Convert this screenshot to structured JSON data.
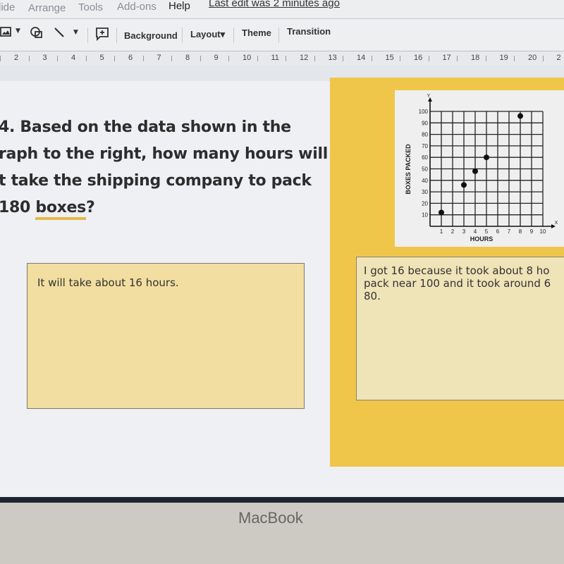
{
  "menubar": {
    "items": [
      "lide",
      "Arrange",
      "Tools",
      "Add-ons",
      "Help"
    ],
    "last_edit": "Last edit was 2 minutes ago"
  },
  "toolbar": {
    "icons": [
      "image-icon",
      "shape-icon",
      "line-icon",
      "comment-add-icon"
    ],
    "buttons": [
      "Background",
      "Layout",
      "Theme",
      "Transition"
    ],
    "layout_arrow": "▾"
  },
  "ruler": {
    "numbers": [
      "2",
      "3",
      "4",
      "5",
      "6",
      "7",
      "8",
      "9",
      "10",
      "11",
      "12",
      "13",
      "14",
      "15",
      "16",
      "17",
      "18",
      "19",
      "20",
      "2"
    ]
  },
  "slide": {
    "question_lines": [
      "4. Based on the data shown in the",
      "raph to the right, how many hours will",
      "t take the shipping company to pack",
      "180 boxes?"
    ],
    "answer": "It will take about 16 hours.",
    "explanation": "I got 16 because it took about 8 ho\npack near 100 and it took around 6\n80."
  },
  "colors": {
    "panel": "#f0c64a",
    "answer_box": "#f2dea0",
    "highlight": "#e6b84a"
  },
  "bezel": {
    "brand": "MacBook"
  },
  "chart_data": {
    "type": "scatter",
    "title": "",
    "xlabel": "HOURS",
    "ylabel": "BOXES PACKED",
    "x_axis_letter": "X",
    "y_axis_letter": "Y",
    "xlim": [
      0,
      10
    ],
    "ylim": [
      0,
      100
    ],
    "x_ticks": [
      "1",
      "2",
      "3",
      "4",
      "5",
      "6",
      "7",
      "8",
      "9",
      "10"
    ],
    "y_ticks": [
      "10",
      "20",
      "30",
      "40",
      "50",
      "60",
      "70",
      "80",
      "90",
      "100"
    ],
    "grid": true,
    "points": [
      {
        "x": 1,
        "y": 12
      },
      {
        "x": 3,
        "y": 36
      },
      {
        "x": 4,
        "y": 48
      },
      {
        "x": 5,
        "y": 60
      },
      {
        "x": 8,
        "y": 96
      }
    ]
  }
}
